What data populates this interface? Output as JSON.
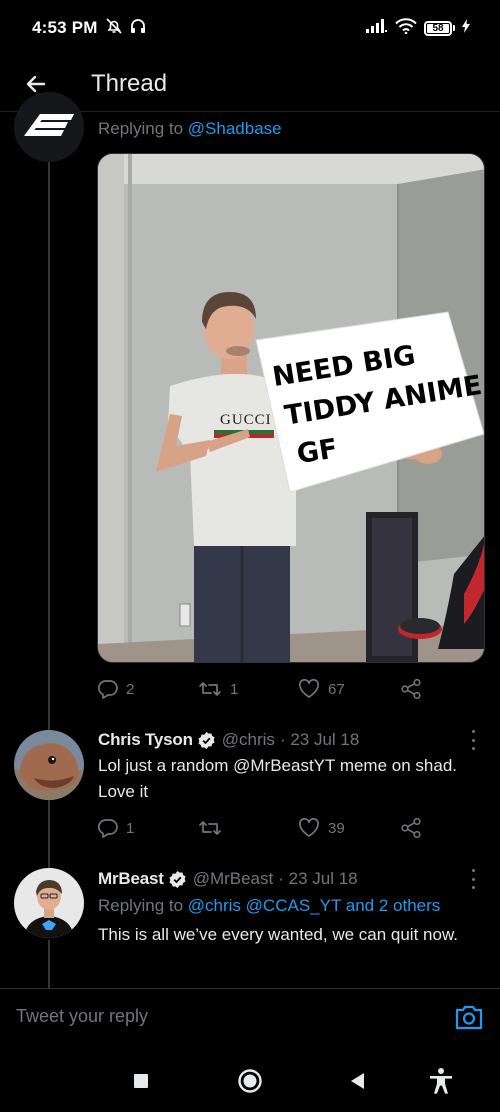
{
  "status_bar": {
    "time": "4:53 PM",
    "battery_level": "58"
  },
  "header": {
    "title": "Thread"
  },
  "main_tweet": {
    "replying_prefix": "Replying to",
    "replying_to": "@Shadbase",
    "image": {
      "sign_text": [
        "NEED BIG",
        "TIDDY ANIME",
        "GF"
      ],
      "shirt_text": "GUCCI"
    },
    "stats": {
      "replies": "2",
      "retweets": "1",
      "likes": "67"
    }
  },
  "replies": [
    {
      "name": "Chris Tyson",
      "handle": "@chris",
      "date": "· 23 Jul 18",
      "text": "Lol just a random @MrBeastYT meme on shad. Love it",
      "stats": {
        "replies": "1",
        "retweets": "",
        "likes": "39"
      }
    },
    {
      "name": "MrBeast",
      "handle": "@MrBeast",
      "date": "· 23 Jul 18",
      "replying_prefix": "Replying to",
      "replying_to": "@chris @CCAS_YT and 2 others",
      "text": "This is all we’ve every wanted, we can quit now."
    }
  ],
  "composer": {
    "placeholder": "Tweet your reply"
  },
  "colors": {
    "background": "#000000",
    "text": "#e7e9ea",
    "muted": "#71767b",
    "accent": "#1d9bf0"
  }
}
